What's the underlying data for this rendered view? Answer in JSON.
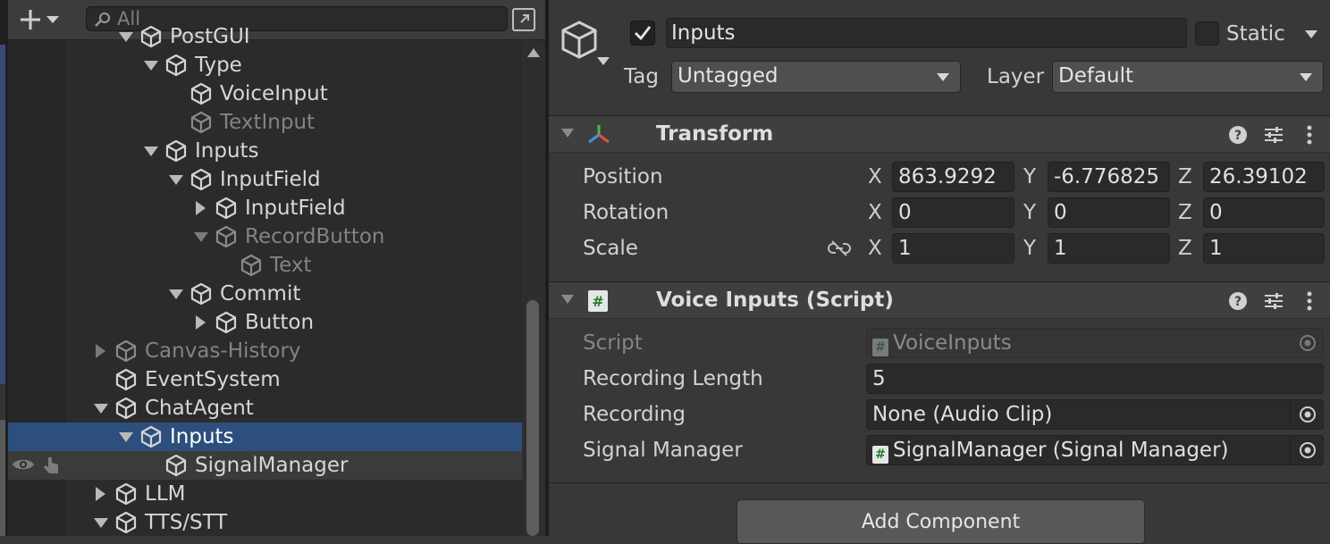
{
  "hierarchy": {
    "search": {
      "placeholder": "All"
    },
    "rows": [
      {
        "label": "PostGUI",
        "depth": 1,
        "arrow": "down",
        "state": "normal"
      },
      {
        "label": "Type",
        "depth": 2,
        "arrow": "down",
        "state": "normal"
      },
      {
        "label": "VoiceInput",
        "depth": 3,
        "arrow": "none",
        "state": "normal"
      },
      {
        "label": "TextInput",
        "depth": 3,
        "arrow": "none",
        "state": "dim"
      },
      {
        "label": "Inputs",
        "depth": 2,
        "arrow": "down",
        "state": "normal"
      },
      {
        "label": "InputField",
        "depth": 3,
        "arrow": "down",
        "state": "normal"
      },
      {
        "label": "InputField",
        "depth": 4,
        "arrow": "right",
        "state": "normal"
      },
      {
        "label": "RecordButton",
        "depth": 4,
        "arrow": "down",
        "state": "dim"
      },
      {
        "label": "Text",
        "depth": 5,
        "arrow": "none",
        "state": "dim"
      },
      {
        "label": "Commit",
        "depth": 3,
        "arrow": "down",
        "state": "normal"
      },
      {
        "label": "Button",
        "depth": 4,
        "arrow": "right",
        "state": "normal"
      },
      {
        "label": "Canvas-History",
        "depth": 0,
        "arrow": "right",
        "state": "dim"
      },
      {
        "label": "EventSystem",
        "depth": 0,
        "arrow": "none",
        "state": "normal"
      },
      {
        "label": "ChatAgent",
        "depth": 0,
        "arrow": "down",
        "state": "normal"
      },
      {
        "label": "Inputs",
        "depth": 1,
        "arrow": "down",
        "state": "selected"
      },
      {
        "label": "SignalManager",
        "depth": 2,
        "arrow": "none",
        "state": "hover"
      },
      {
        "label": "LLM",
        "depth": 0,
        "arrow": "right",
        "state": "normal"
      },
      {
        "label": "TTS/STT",
        "depth": 0,
        "arrow": "down",
        "state": "normal"
      }
    ]
  },
  "inspector": {
    "object_name": "Inputs",
    "active": true,
    "static_label": "Static",
    "static_checked": false,
    "tag_label": "Tag",
    "tag_value": "Untagged",
    "layer_label": "Layer",
    "layer_value": "Default",
    "transform": {
      "title": "Transform",
      "position_label": "Position",
      "rotation_label": "Rotation",
      "scale_label": "Scale",
      "axes": {
        "x": "X",
        "y": "Y",
        "z": "Z"
      },
      "position": {
        "x": "863.9292",
        "y": "-6.776825",
        "z": "26.39102"
      },
      "rotation": {
        "x": "0",
        "y": "0",
        "z": "0"
      },
      "scale": {
        "x": "1",
        "y": "1",
        "z": "1"
      }
    },
    "voice_inputs": {
      "title": "Voice Inputs (Script)",
      "script_label": "Script",
      "script_value": "VoiceInputs",
      "recording_length_label": "Recording Length",
      "recording_length_value": "5",
      "recording_label": "Recording",
      "recording_value": "None (Audio Clip)",
      "signal_manager_label": "Signal Manager",
      "signal_manager_value": "SignalManager (Signal Manager)"
    },
    "add_component_label": "Add Component"
  },
  "colors": {
    "selection": "#2d4f7d",
    "panel_bg": "#383838",
    "hierarchy_bg": "#2b2b2b",
    "script_icon_green": "#1e7d2a"
  }
}
